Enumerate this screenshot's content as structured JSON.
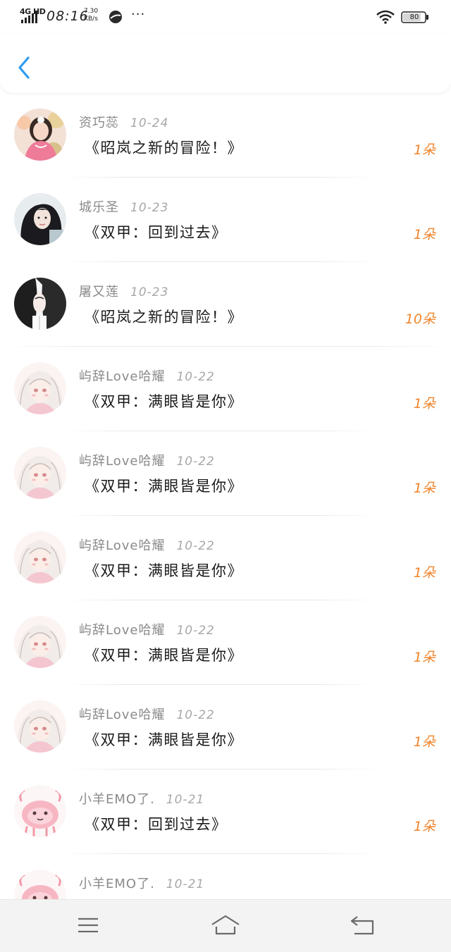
{
  "status_bar": {
    "network": "4G HD",
    "time": "08:16",
    "speed_value": "7.30",
    "speed_unit": "KB/s",
    "more": "···",
    "battery": "80"
  },
  "header": {
    "back_icon": "chevron-left-icon",
    "accent_color": "#2e9bf0"
  },
  "records": [
    {
      "name": "资巧蕊",
      "date": "10-24",
      "title": "《昭岚之新的冒险！》",
      "amount": "1朵",
      "avatar": "pink-girl-avatar"
    },
    {
      "name": "城乐圣",
      "date": "10-23",
      "title": "《双甲：回到过去》",
      "amount": "1朵",
      "avatar": "dark-hair-girl-avatar"
    },
    {
      "name": "屠又莲",
      "date": "10-23",
      "title": "《昭岚之新的冒险！》",
      "amount": "10朵",
      "avatar": "anime-couple-avatar"
    },
    {
      "name": "屿辞Love哈耀",
      "date": "10-22",
      "title": "《双甲：满眼皆是你》",
      "amount": "1朵",
      "avatar": "anime-white-hair-avatar"
    },
    {
      "name": "屿辞Love哈耀",
      "date": "10-22",
      "title": "《双甲：满眼皆是你》",
      "amount": "1朵",
      "avatar": "anime-white-hair-avatar"
    },
    {
      "name": "屿辞Love哈耀",
      "date": "10-22",
      "title": "《双甲：满眼皆是你》",
      "amount": "1朵",
      "avatar": "anime-white-hair-avatar"
    },
    {
      "name": "屿辞Love哈耀",
      "date": "10-22",
      "title": "《双甲：满眼皆是你》",
      "amount": "1朵",
      "avatar": "anime-white-hair-avatar"
    },
    {
      "name": "屿辞Love哈耀",
      "date": "10-22",
      "title": "《双甲：满眼皆是你》",
      "amount": "1朵",
      "avatar": "anime-white-hair-avatar"
    },
    {
      "name": "小羊EMO了.",
      "date": "10-21",
      "title": "《双甲：回到过去》",
      "amount": "1朵",
      "avatar": "pink-cartoon-avatar"
    },
    {
      "name": "小羊EMO了.",
      "date": "10-21",
      "title": "",
      "amount": "",
      "avatar": "pink-cartoon-avatar"
    }
  ],
  "nav": {
    "menu_icon": "menu-icon",
    "home_icon": "home-icon",
    "back_icon": "return-icon"
  },
  "colors": {
    "amount": "#f0852c",
    "name": "#8a8a8a",
    "title": "#1a1a1a"
  }
}
